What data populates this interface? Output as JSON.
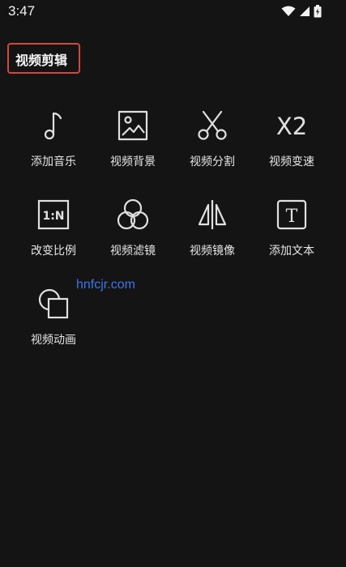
{
  "status_bar": {
    "time": "3:47",
    "icons": [
      "wifi-icon",
      "cellular-signal-icon",
      "battery-charging-icon"
    ]
  },
  "header": {
    "title": "视频剪辑",
    "highlight_color": "#d0483f"
  },
  "tools": [
    {
      "label": "添加音乐",
      "icon": "music-note-icon"
    },
    {
      "label": "视频背景",
      "icon": "image-icon"
    },
    {
      "label": "视频分割",
      "icon": "scissors-icon"
    },
    {
      "label": "视频变速",
      "icon": "speed-x2-icon",
      "icon_text": "X2"
    },
    {
      "label": "改变比例",
      "icon": "aspect-ratio-icon",
      "icon_text": "1:N"
    },
    {
      "label": "视频滤镜",
      "icon": "filter-circles-icon"
    },
    {
      "label": "视频镜像",
      "icon": "mirror-icon"
    },
    {
      "label": "添加文本",
      "icon": "text-icon",
      "icon_text": "T"
    },
    {
      "label": "视频动画",
      "icon": "animation-shapes-icon"
    }
  ],
  "watermark": {
    "text": "hnfcjr.com",
    "color": "#3f74e8"
  },
  "colors": {
    "background": "#141414",
    "icon_stroke": "#e0e0e0",
    "text": "#e6e6e6"
  }
}
